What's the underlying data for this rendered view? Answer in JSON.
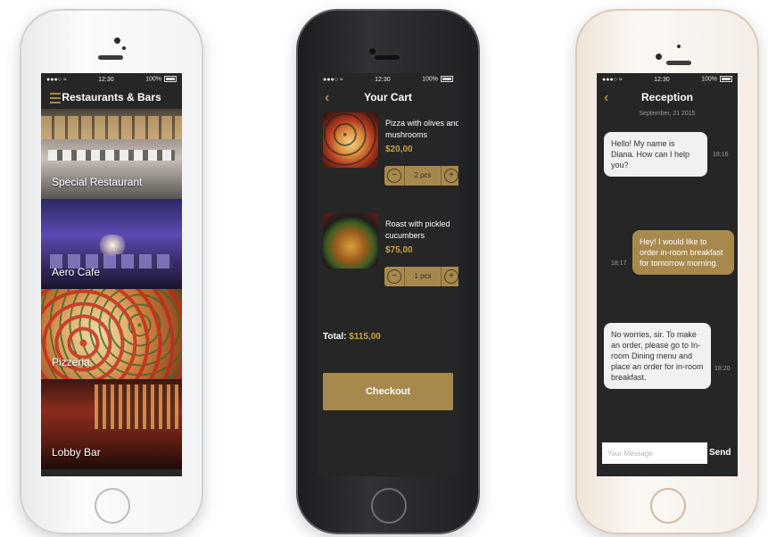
{
  "status": {
    "time": "12:30",
    "battery": "100%"
  },
  "restaurants": {
    "title": "Restaurants & Bars",
    "items": [
      {
        "label": "Special Restaurant"
      },
      {
        "label": "Aero Cafe"
      },
      {
        "label": "Pizzeria"
      },
      {
        "label": "Lobby Bar"
      }
    ]
  },
  "cart": {
    "title": "Your Cart",
    "items": [
      {
        "name": "Pizza with olives and mushrooms",
        "price": "$20,00",
        "qty": "2 pcs"
      },
      {
        "name": "Roast with pickled cucumbers",
        "price": "$75,00",
        "qty": "1 pcs"
      }
    ],
    "total_label": "Total:",
    "total_value": "$115,00",
    "checkout_label": "Checkout"
  },
  "chat": {
    "title": "Reception",
    "date": "September, 21 2015",
    "messages": [
      {
        "from": "in",
        "text": "Hello! My name is Diana. How can I help you?",
        "time": "18:16"
      },
      {
        "from": "out",
        "text": "Hey! I would like to order in-room breakfast for tomorrow morning.",
        "time": "18:17"
      },
      {
        "from": "in",
        "text": "No worries, sir. To make an order, please go to In-room Dining menu and place an order for in-room breakfast.",
        "time": "18:20"
      }
    ],
    "input_placeholder": "Your Message",
    "send_label": "Send"
  },
  "colors": {
    "accent": "#a8894d",
    "screen_bg": "#262626"
  },
  "icons": {
    "back": "chevron-left-icon",
    "menu": "hamburger-icon",
    "minus": "minus-icon",
    "plus": "plus-icon"
  }
}
